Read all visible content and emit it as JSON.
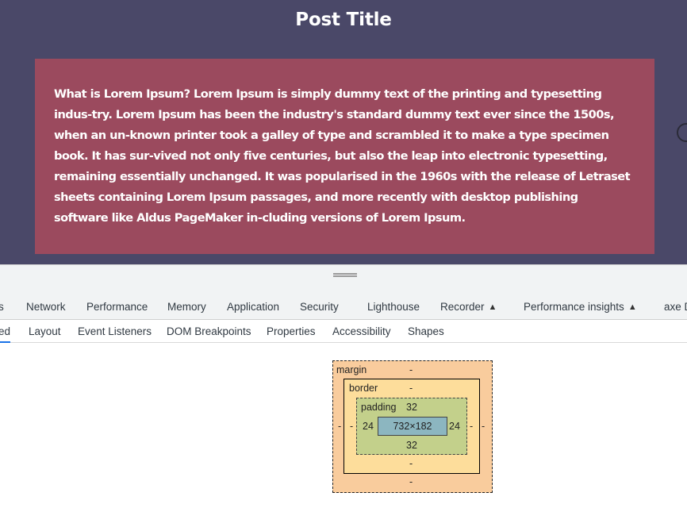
{
  "page": {
    "title": "Post Title",
    "body": "What is Lorem Ipsum? Lorem Ipsum is simply dummy text of the printing and typesetting indus-try. Lorem Ipsum has been the industry's standard dummy text ever since the 1500s, when an un-known printer took a galley of type and scrambled it to make a type specimen book. It has sur-vived not only five centuries, but also the leap into electronic typesetting, remaining essentially unchanged. It was popularised in the 1960s with the release of Letraset sheets containing Lorem Ipsum passages, and more recently with desktop publishing software like Aldus PageMaker in-cluding versions of Lorem Ipsum.",
    "colors": {
      "background": "#4a4868",
      "card": "#9b4a5e",
      "text": "#ffffff"
    }
  },
  "devtools": {
    "tabs": [
      "s",
      "Network",
      "Performance",
      "Memory",
      "Application",
      "Security",
      "Lighthouse",
      "Recorder",
      "Performance insights",
      "axe D"
    ],
    "experimental_icon": "beaker-icon",
    "subtabs": [
      "ed",
      "Layout",
      "Event Listeners",
      "DOM Breakpoints",
      "Properties",
      "Accessibility",
      "Shapes"
    ],
    "box_model": {
      "margin_label": "margin",
      "border_label": "border",
      "padding_label": "padding",
      "margin": {
        "top": "-",
        "right": "-",
        "bottom": "-",
        "left": "-"
      },
      "border": {
        "top": "-",
        "right": "-",
        "bottom": "-",
        "left": "-"
      },
      "padding": {
        "top": "32",
        "right": "24",
        "bottom": "32",
        "left": "24"
      },
      "content_size": "732×182",
      "colors": {
        "margin": "#f9cc9d",
        "border": "#fddd9b",
        "padding": "#c3d08b",
        "content": "#8cb6c0"
      }
    }
  }
}
